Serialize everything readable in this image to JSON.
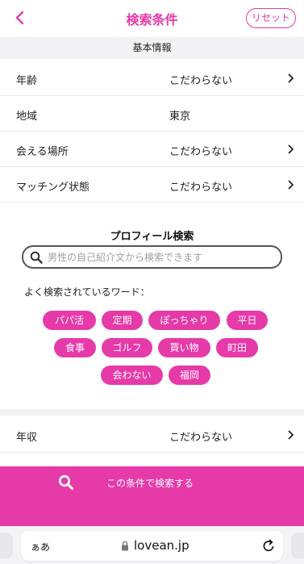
{
  "header": {
    "title": "検索条件",
    "reset_label": "リセット",
    "accent": "#e63aa8"
  },
  "basic": {
    "section_title": "基本情報",
    "rows": [
      {
        "label": "年齢",
        "value": "こだわらない",
        "has_chevron": true
      },
      {
        "label": "地域",
        "value": "東京",
        "has_chevron": false
      },
      {
        "label": "会える場所",
        "value": "こだわらない",
        "has_chevron": true
      },
      {
        "label": "マッチング状態",
        "value": "こだわらない",
        "has_chevron": true
      }
    ]
  },
  "profile_search": {
    "title": "プロフィール検索",
    "placeholder": "男性の自己紹介文から検索できます",
    "keywords_label": "よく検索されているワード：",
    "tags": [
      "パパ活",
      "定期",
      "ぽっちゃり",
      "平日",
      "食事",
      "ゴルフ",
      "買い物",
      "町田",
      "会わない",
      "福岡"
    ]
  },
  "income_row": {
    "label": "年収",
    "value": "こだわらない",
    "has_chevron": true
  },
  "search_button": {
    "label": "この条件で検索する"
  },
  "browser": {
    "aa_label": "ぁあ",
    "url": "lovean.jp"
  },
  "icons": [
    "back-chevron-icon",
    "chevron-right-icon",
    "search-icon",
    "lock-icon",
    "reload-icon"
  ]
}
